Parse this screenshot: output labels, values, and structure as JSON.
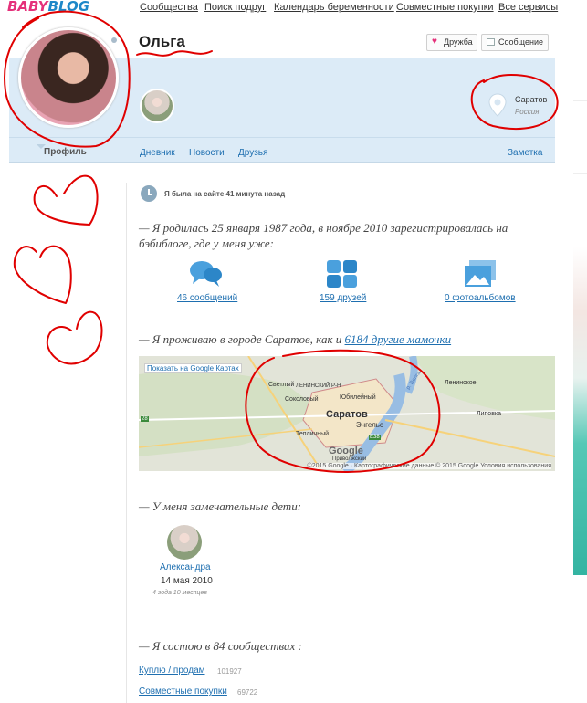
{
  "brand": {
    "part1": "BABY",
    "part2": "BLOG"
  },
  "nav": [
    "Сообщества",
    "Поиск подруг",
    "Календарь беременности",
    "Совместные покупки",
    "Все сервисы"
  ],
  "profile": {
    "name": "Ольга",
    "friend_button": "Дружба",
    "message_button": "Сообщение",
    "city": "Саратов",
    "country": "Россия"
  },
  "tabs": {
    "active": "Профиль",
    "diary": "Дневник",
    "news": "Новости",
    "friends": "Друзья",
    "note": "Заметка"
  },
  "last_seen": "Я была на сайте 41 минута назад",
  "registration": "— Я родилась 25 января 1987 года, в ноябре 2010 зарегистрировалась на бэбиблоге, где у меня уже:",
  "stats": {
    "messages": "46 сообщений",
    "friends": "159 друзей",
    "albums": "0 фотоальбомов"
  },
  "location_text": "— Я проживаю в городе Саратов, как и",
  "location_link": "6184 другие мамочки",
  "map": {
    "show_link": "Показать на Google Картах",
    "copyright": "©2015 Google · Картографические данные © 2015 Google   Условия использования",
    "labels": [
      "Светлый",
      "ЛЕНИНСКИЙ Р-Н",
      "Юбилейный",
      "Соколовый",
      "Саратов",
      "Энгельс",
      "Тепличный",
      "Ленинское",
      "Липовка",
      "р. Волга",
      "Google",
      "Приволжский",
      "28",
      "E38"
    ]
  },
  "children_heading": "— У меня замечательные дети:",
  "child": {
    "name": "Александра",
    "dob": "14 мая 2010",
    "age": "4 года 10 месяцев"
  },
  "communities_heading": "— Я состою в 84 сообществах :",
  "communities": [
    {
      "name": "Куплю / продам",
      "count": "101927"
    },
    {
      "name": "Совместные покупки",
      "count": "69722"
    }
  ],
  "colors": {
    "accent": "#1e6fb0",
    "brand_pink": "#e5317a",
    "panel": "#dcebf7",
    "annotation": "#e00000"
  }
}
